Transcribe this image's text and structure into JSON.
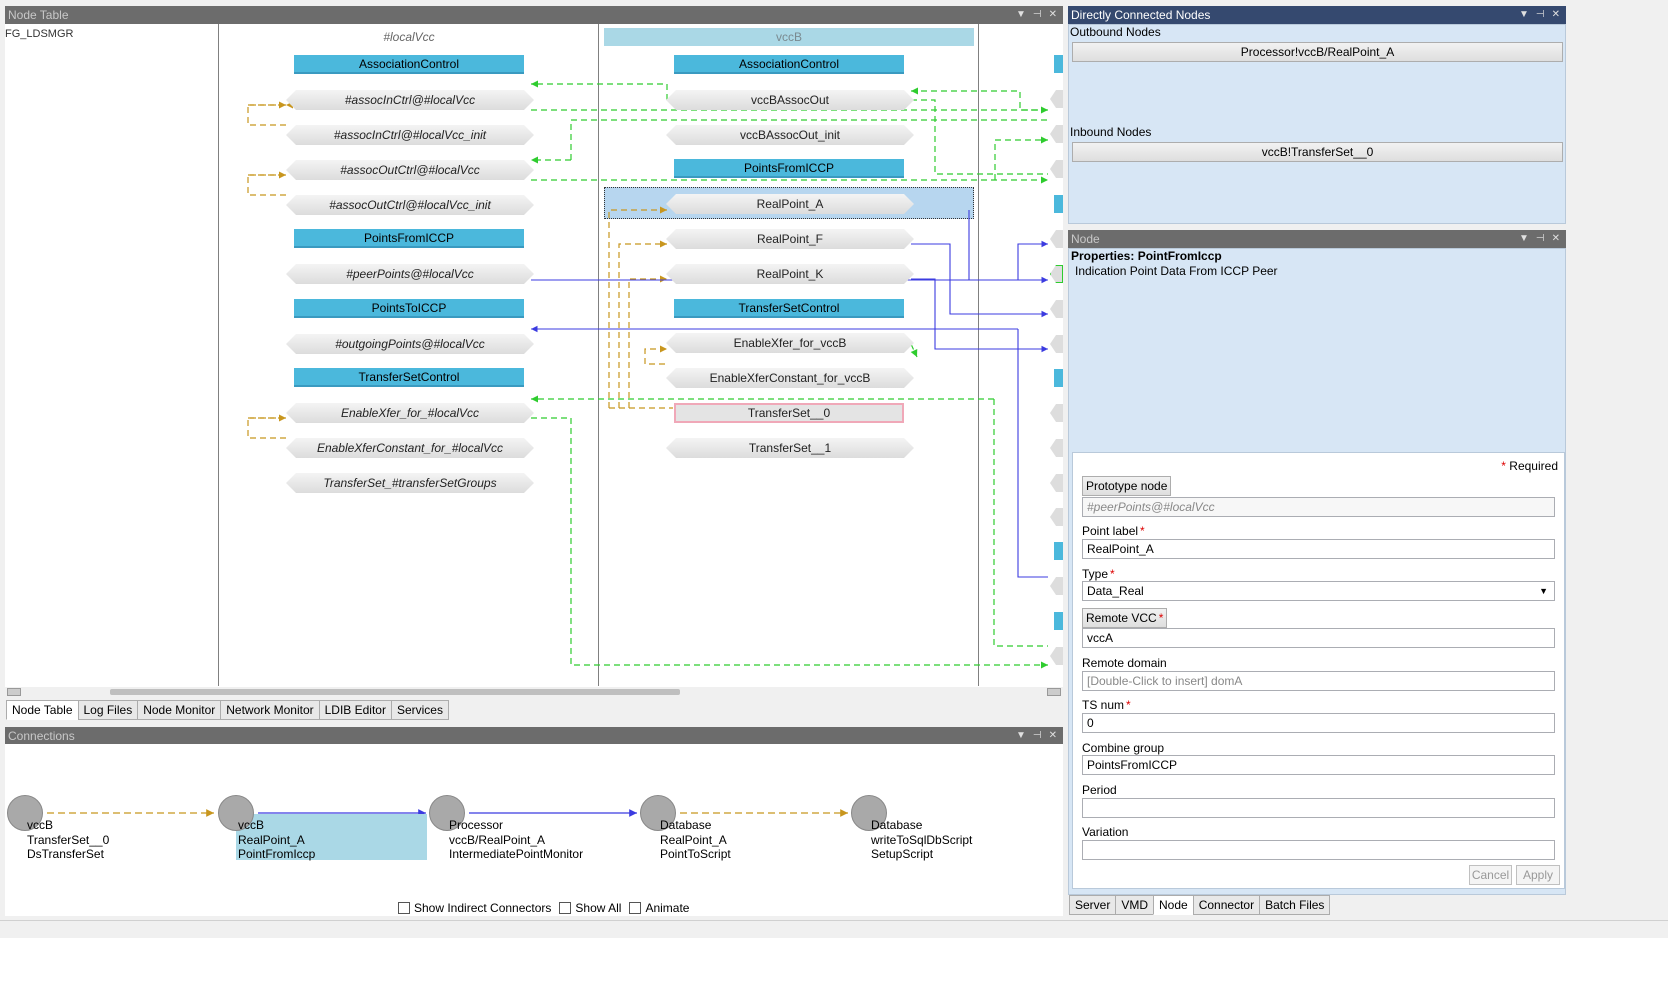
{
  "node_table": {
    "title": "Node Table",
    "left_column_label": "FG_LDSMGR",
    "col1_header": "#localVcc",
    "col2_header": "vccB",
    "col1_nodes": [
      {
        "label": "AssociationControl",
        "kind": "group"
      },
      {
        "label": "#assocInCtrl@#localVcc",
        "kind": "point"
      },
      {
        "label": "#assocInCtrl@#localVcc_init",
        "kind": "point"
      },
      {
        "label": "#assocOutCtrl@#localVcc",
        "kind": "point"
      },
      {
        "label": "#assocOutCtrl@#localVcc_init",
        "kind": "point"
      },
      {
        "label": "PointsFromICCP",
        "kind": "group"
      },
      {
        "label": "#peerPoints@#localVcc",
        "kind": "point"
      },
      {
        "label": "PointsToICCP",
        "kind": "group"
      },
      {
        "label": "#outgoingPoints@#localVcc",
        "kind": "point"
      },
      {
        "label": "TransferSetControl",
        "kind": "group"
      },
      {
        "label": "EnableXfer_for_#localVcc",
        "kind": "point"
      },
      {
        "label": "EnableXferConstant_for_#localVcc",
        "kind": "point"
      },
      {
        "label": "TransferSet_#transferSetGroups",
        "kind": "point"
      }
    ],
    "col2_nodes": [
      {
        "label": "AssociationControl",
        "kind": "group"
      },
      {
        "label": "vccBAssocOut",
        "kind": "point"
      },
      {
        "label": "vccBAssocOut_init",
        "kind": "point"
      },
      {
        "label": "PointsFromICCP",
        "kind": "group"
      },
      {
        "label": "RealPoint_A",
        "kind": "point"
      },
      {
        "label": "RealPoint_F",
        "kind": "point"
      },
      {
        "label": "RealPoint_K",
        "kind": "point"
      },
      {
        "label": "TransferSetControl",
        "kind": "group"
      },
      {
        "label": "EnableXfer_for_vccB",
        "kind": "point"
      },
      {
        "label": "EnableXferConstant_for_vccB",
        "kind": "point"
      },
      {
        "label": "TransferSet__0",
        "kind": "point"
      },
      {
        "label": "TransferSet__1",
        "kind": "point"
      }
    ]
  },
  "bottom_tabs": [
    "Node Table",
    "Log Files",
    "Node Monitor",
    "Network Monitor",
    "LDIB Editor",
    "Services"
  ],
  "connections": {
    "title": "Connections",
    "nodes": [
      {
        "line1": "vccB",
        "line2": "TransferSet__0",
        "line3": "DsTransferSet"
      },
      {
        "line1": "vccB",
        "line2": "RealPoint_A",
        "line3": "PointFromIccp"
      },
      {
        "line1": "Processor",
        "line2": "vccB/RealPoint_A",
        "line3": "IntermediatePointMonitor"
      },
      {
        "line1": "Database",
        "line2": "RealPoint_A",
        "line3": "PointToScript"
      },
      {
        "line1": "Database",
        "line2": "writeToSqlDbScript",
        "line3": "SetupScript"
      }
    ],
    "checkboxes": [
      "Show Indirect Connectors",
      "Show All",
      "Animate"
    ]
  },
  "directly_connected": {
    "title": "Directly Connected Nodes",
    "outbound_label": "Outbound Nodes",
    "outbound_item": "Processor!vccB/RealPoint_A",
    "inbound_label": "Inbound Nodes",
    "inbound_item": "vccB!TransferSet__0"
  },
  "node_panel": {
    "title": "Node",
    "properties_label": "Properties:",
    "properties_name": "PointFromIccp",
    "description": "Indication Point Data From ICCP Peer"
  },
  "form": {
    "required_note": "Required",
    "prototype_btn": "Prototype node",
    "prototype_value": "#peerPoints@#localVcc",
    "point_label_lbl": "Point label",
    "point_label_val": "RealPoint_A",
    "type_lbl": "Type",
    "type_val": "Data_Real",
    "remote_vcc_btn": "Remote VCC",
    "remote_vcc_val": "vccA",
    "remote_domain_lbl": "Remote domain",
    "remote_domain_ph": "[Double-Click to insert] domA",
    "ts_num_lbl": "TS num",
    "ts_num_val": "0",
    "combine_lbl": "Combine group",
    "combine_val": "PointsFromICCP",
    "period_lbl": "Period",
    "variation_lbl": "Variation",
    "cancel": "Cancel",
    "apply": "Apply"
  },
  "right_tabs": [
    "Server",
    "VMD",
    "Node",
    "Connector",
    "Batch Files"
  ],
  "colors": {
    "group": "#4bb8dc",
    "assoc_link": "#2ecc2e",
    "xfer_link": "#c8961e",
    "point_link": "#3b3be0",
    "selection": "#b7d6ef"
  }
}
